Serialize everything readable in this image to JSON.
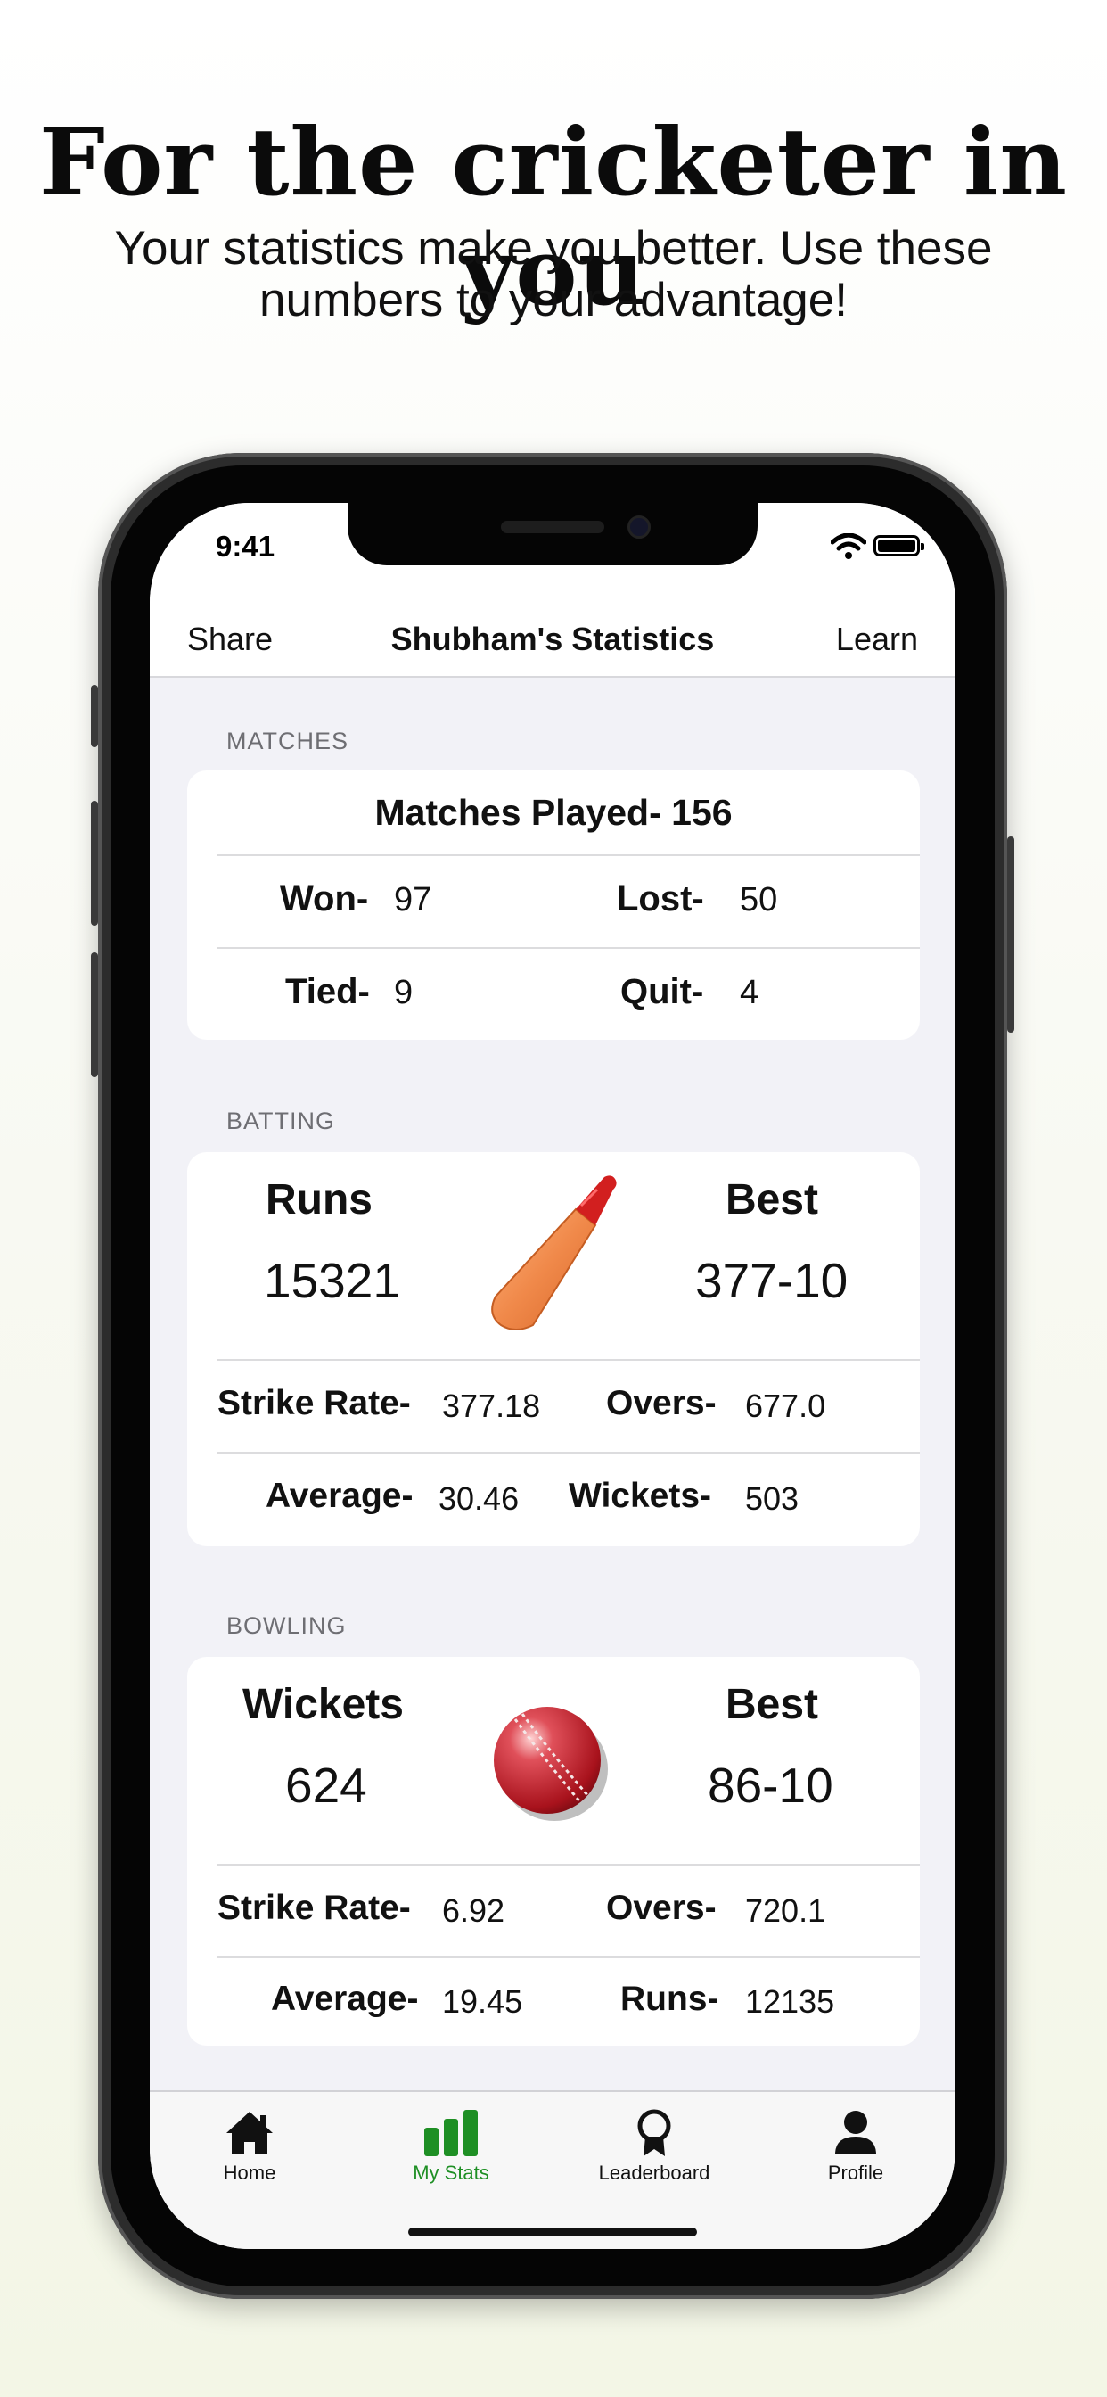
{
  "promo": {
    "headline": "For the cricketer in you",
    "subline": "Your statistics make you better. Use these numbers to your advantage!"
  },
  "status": {
    "time": "9:41"
  },
  "nav": {
    "left": "Share",
    "title": "Shubham's Statistics",
    "right": "Learn"
  },
  "matches": {
    "section": "MATCHES",
    "played": "Matches Played- 156",
    "won_label": "Won-",
    "won": "97",
    "lost_label": "Lost-",
    "lost": "50",
    "tied_label": "Tied-",
    "tied": "9",
    "quit_label": "Quit-",
    "quit": "4"
  },
  "batting": {
    "section": "BATTING",
    "runs_label": "Runs",
    "runs": "15321",
    "best_label": "Best",
    "best": "377-10",
    "sr_label": "Strike Rate-",
    "sr": "377.18",
    "overs_label": "Overs-",
    "overs": "677.0",
    "avg_label": "Average-",
    "avg": "30.46",
    "wkts_label": "Wickets-",
    "wkts": "503",
    "icon": "cricket-bat-icon"
  },
  "bowling": {
    "section": "BOWLING",
    "wickets_label": "Wickets",
    "wickets": "624",
    "best_label": "Best",
    "best": "86-10",
    "sr_label": "Strike Rate-",
    "sr": "6.92",
    "overs_label": "Overs-",
    "overs": "720.1",
    "avg_label": "Average-",
    "avg": "19.45",
    "runs_label": "Runs-",
    "runs": "12135",
    "icon": "cricket-ball-icon"
  },
  "tabs": [
    {
      "label": "Home",
      "icon": "home-icon"
    },
    {
      "label": "My Stats",
      "icon": "bar-chart-icon",
      "active": true
    },
    {
      "label": "Leaderboard",
      "icon": "award-ribbon-icon"
    },
    {
      "label": "Profile",
      "icon": "person-icon"
    }
  ],
  "colors": {
    "accent": "#1e8f24",
    "bat": "#f0894a",
    "ball": "#c8202a"
  }
}
